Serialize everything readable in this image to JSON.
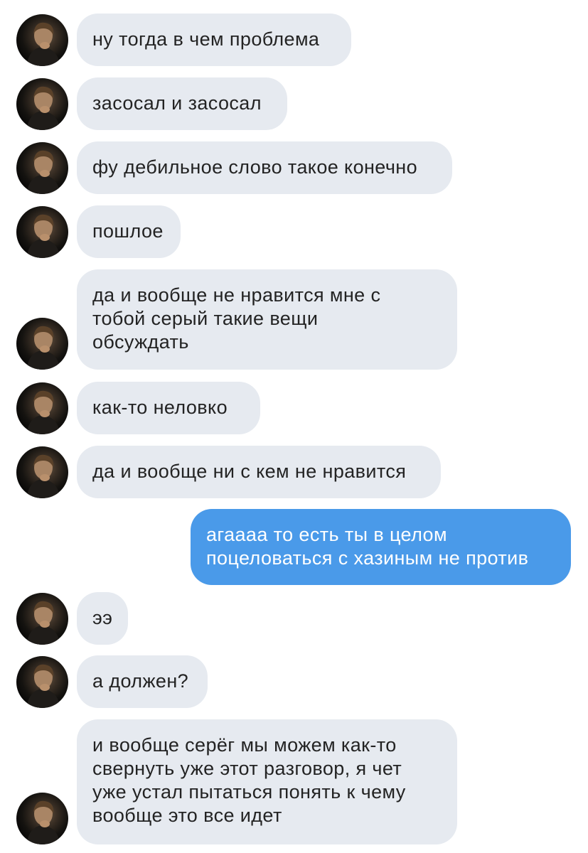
{
  "conversation": {
    "messages": [
      {
        "id": 0,
        "direction": "in",
        "text": "ну тогда в чем проблема",
        "avatar": "contact-avatar"
      },
      {
        "id": 1,
        "direction": "in",
        "text": "засосал и засосал",
        "avatar": "contact-avatar"
      },
      {
        "id": 2,
        "direction": "in",
        "text": "фу дебильное слово такое конечно",
        "avatar": "contact-avatar"
      },
      {
        "id": 3,
        "direction": "in",
        "text": "пошлое",
        "avatar": "contact-avatar"
      },
      {
        "id": 4,
        "direction": "in",
        "text": "да и вообще не нравится мне с\nтобой серый такие вещи\nобсуждать",
        "avatar": "contact-avatar"
      },
      {
        "id": 5,
        "direction": "in",
        "text": "как-то неловко",
        "avatar": "contact-avatar"
      },
      {
        "id": 6,
        "direction": "in",
        "text": "да и вообще ни с кем не нравится",
        "avatar": "contact-avatar"
      },
      {
        "id": 7,
        "direction": "out",
        "text": "агаааа то есть ты в целом\nпоцеловаться с хазиным не против"
      },
      {
        "id": 8,
        "direction": "in",
        "text": "ээ",
        "avatar": "contact-avatar"
      },
      {
        "id": 9,
        "direction": "in",
        "text": "а должен?",
        "avatar": "contact-avatar"
      },
      {
        "id": 10,
        "direction": "in",
        "text": "и вообще серёг мы можем как-то\nсвернуть уже этот разговор, я чет\nуже устал пытаться понять к чему\nвообще это все идет",
        "avatar": "contact-avatar"
      }
    ]
  },
  "colors": {
    "incoming_bubble": "#e6eaf0",
    "outgoing_bubble": "#4a9ae9",
    "incoming_text": "#232323",
    "outgoing_text": "#ffffff"
  }
}
